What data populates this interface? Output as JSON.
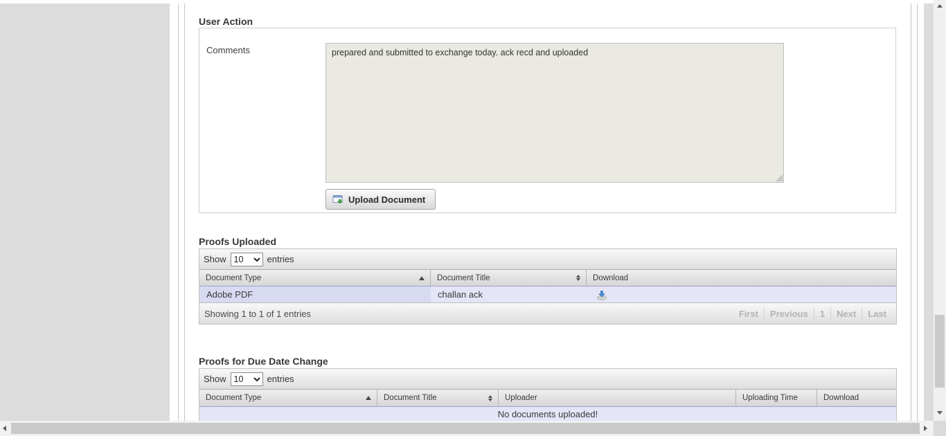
{
  "colors": {
    "row_highlight": "#e4e5f7",
    "sorted_column_highlight": "#d8daf2",
    "textarea_background": "#eaeae2",
    "download_icon_blue": "#4a90d9",
    "sidebar_gray": "#dcdcdc"
  },
  "user_action": {
    "title": "User Action",
    "comments_label": "Comments",
    "comments_value": "prepared and submitted to exchange today. ack recd and uploaded",
    "upload_button_label": "Upload Document"
  },
  "proofs_uploaded": {
    "title": "Proofs Uploaded",
    "show_label": "Show",
    "entries_label": "entries",
    "page_size": "10",
    "columns": [
      {
        "label": "Document Type",
        "sort": "asc"
      },
      {
        "label": "Document Title",
        "sort": "both"
      },
      {
        "label": "Download",
        "sort": "none"
      }
    ],
    "row": {
      "document_type": "Adobe PDF",
      "document_title": "challan ack",
      "download_icon": "download-to-disk-icon"
    },
    "info": "Showing 1 to 1 of 1 entries",
    "pagination": [
      "First",
      "Previous",
      "1",
      "Next",
      "Last"
    ]
  },
  "proofs_due_date_change": {
    "title": "Proofs for Due Date Change",
    "show_label": "Show",
    "entries_label": "entries",
    "page_size": "10",
    "columns": [
      {
        "label": "Document Type",
        "sort": "asc"
      },
      {
        "label": "Document Title",
        "sort": "both"
      },
      {
        "label": "Uploader",
        "sort": "none"
      },
      {
        "label": "Uploading Time",
        "sort": "none"
      },
      {
        "label": "Download",
        "sort": "none"
      }
    ],
    "empty_message": "No documents uploaded!"
  }
}
